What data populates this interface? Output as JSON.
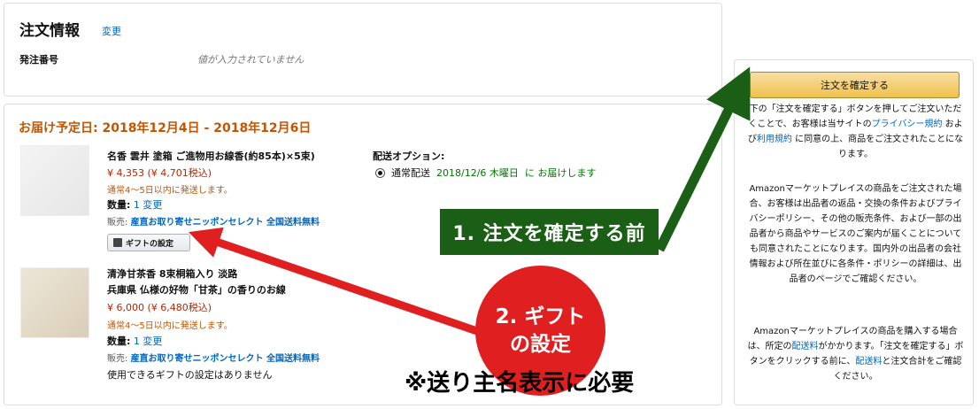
{
  "order_info": {
    "title": "注文情報",
    "change_link": "変更",
    "order_number_label": "発注番号",
    "order_number_placeholder": "値が入力されていません"
  },
  "delivery": {
    "date_text": "お届け予定日: 2018年12月4日 - 2018年12月6日",
    "items": [
      {
        "title": "名香 雲井 塗箱 ご進物用お線香(約85本)×5束)",
        "price": "¥ 4,353 (¥ 4,701税込)",
        "shipping": "通常4～5日以内に発送します。",
        "qty_label": "数量:",
        "qty_value": "1",
        "qty_change": "変更",
        "seller_label": "販売:",
        "seller_name": "産直お取り寄せニッポンセレクト 全国送料無料",
        "gift_button": "ギフトの設定"
      },
      {
        "title_line1": "清浄甘茶香 8束桐箱入り 淡路",
        "title_line2": "兵庫県 仏様の好物「甘茶」の香りのお線",
        "price": "¥ 6,000 (¥ 6,480税込)",
        "shipping": "通常4～5日以内に発送します。",
        "qty_label": "数量:",
        "qty_value": "1",
        "qty_change": "変更",
        "seller_label": "販売:",
        "seller_name": "産直お取り寄せニッポンセレクト 全国送料無料",
        "no_gift": "使用できるギフトの設定はありません"
      }
    ],
    "option_title": "配送オプション:",
    "option_label": "通常配送",
    "option_date": "2018/12/6 木曜日",
    "option_suffix": "に お届けします"
  },
  "place_order": {
    "button_label": "注文を確定する",
    "legal1_a": "下の「注文を確定する」ボタンを押してご注文いただくことで、お客様は当サイトの",
    "legal1_link1": "プライバシー規約",
    "legal1_b": "および",
    "legal1_link2": "利用規約",
    "legal1_c": "に同意の上、商品をご注文されたことになります。",
    "legal2": "Amazonマーケットプレイスの商品をご注文された場合、お客様は出品者の返品・交換の条件およびプライバシーポリシー、その他の販売条件、および一部の出品者から商品やサービスのご案内が届くことについても同意されたことになります。国内外の出品者の会社情報および所在並びに各条件・ポリシーの詳細は、出品者のページでご確認ください。",
    "legal3_a": "Amazonマーケットプレイスの商品を購入する場合は、所定の",
    "legal3_link1": "配送料",
    "legal3_b": "がかかります。「注文を確定する」ボタンをクリックする前に、",
    "legal3_link2": "配送料",
    "legal3_c": "と注文合計をご確認ください。"
  },
  "annotations": {
    "green_label": "1. 注文を確定する前",
    "red_line1": "2. ギフト",
    "red_line2": "の設定",
    "note": "※送り主名表示に必要"
  },
  "colors": {
    "accent_orange": "#c45500",
    "link_blue": "#0066c0",
    "price_red": "#b12704",
    "green_annotation": "#1a5f15",
    "red_annotation": "#e02020",
    "button_gold": "#f0c14b"
  }
}
